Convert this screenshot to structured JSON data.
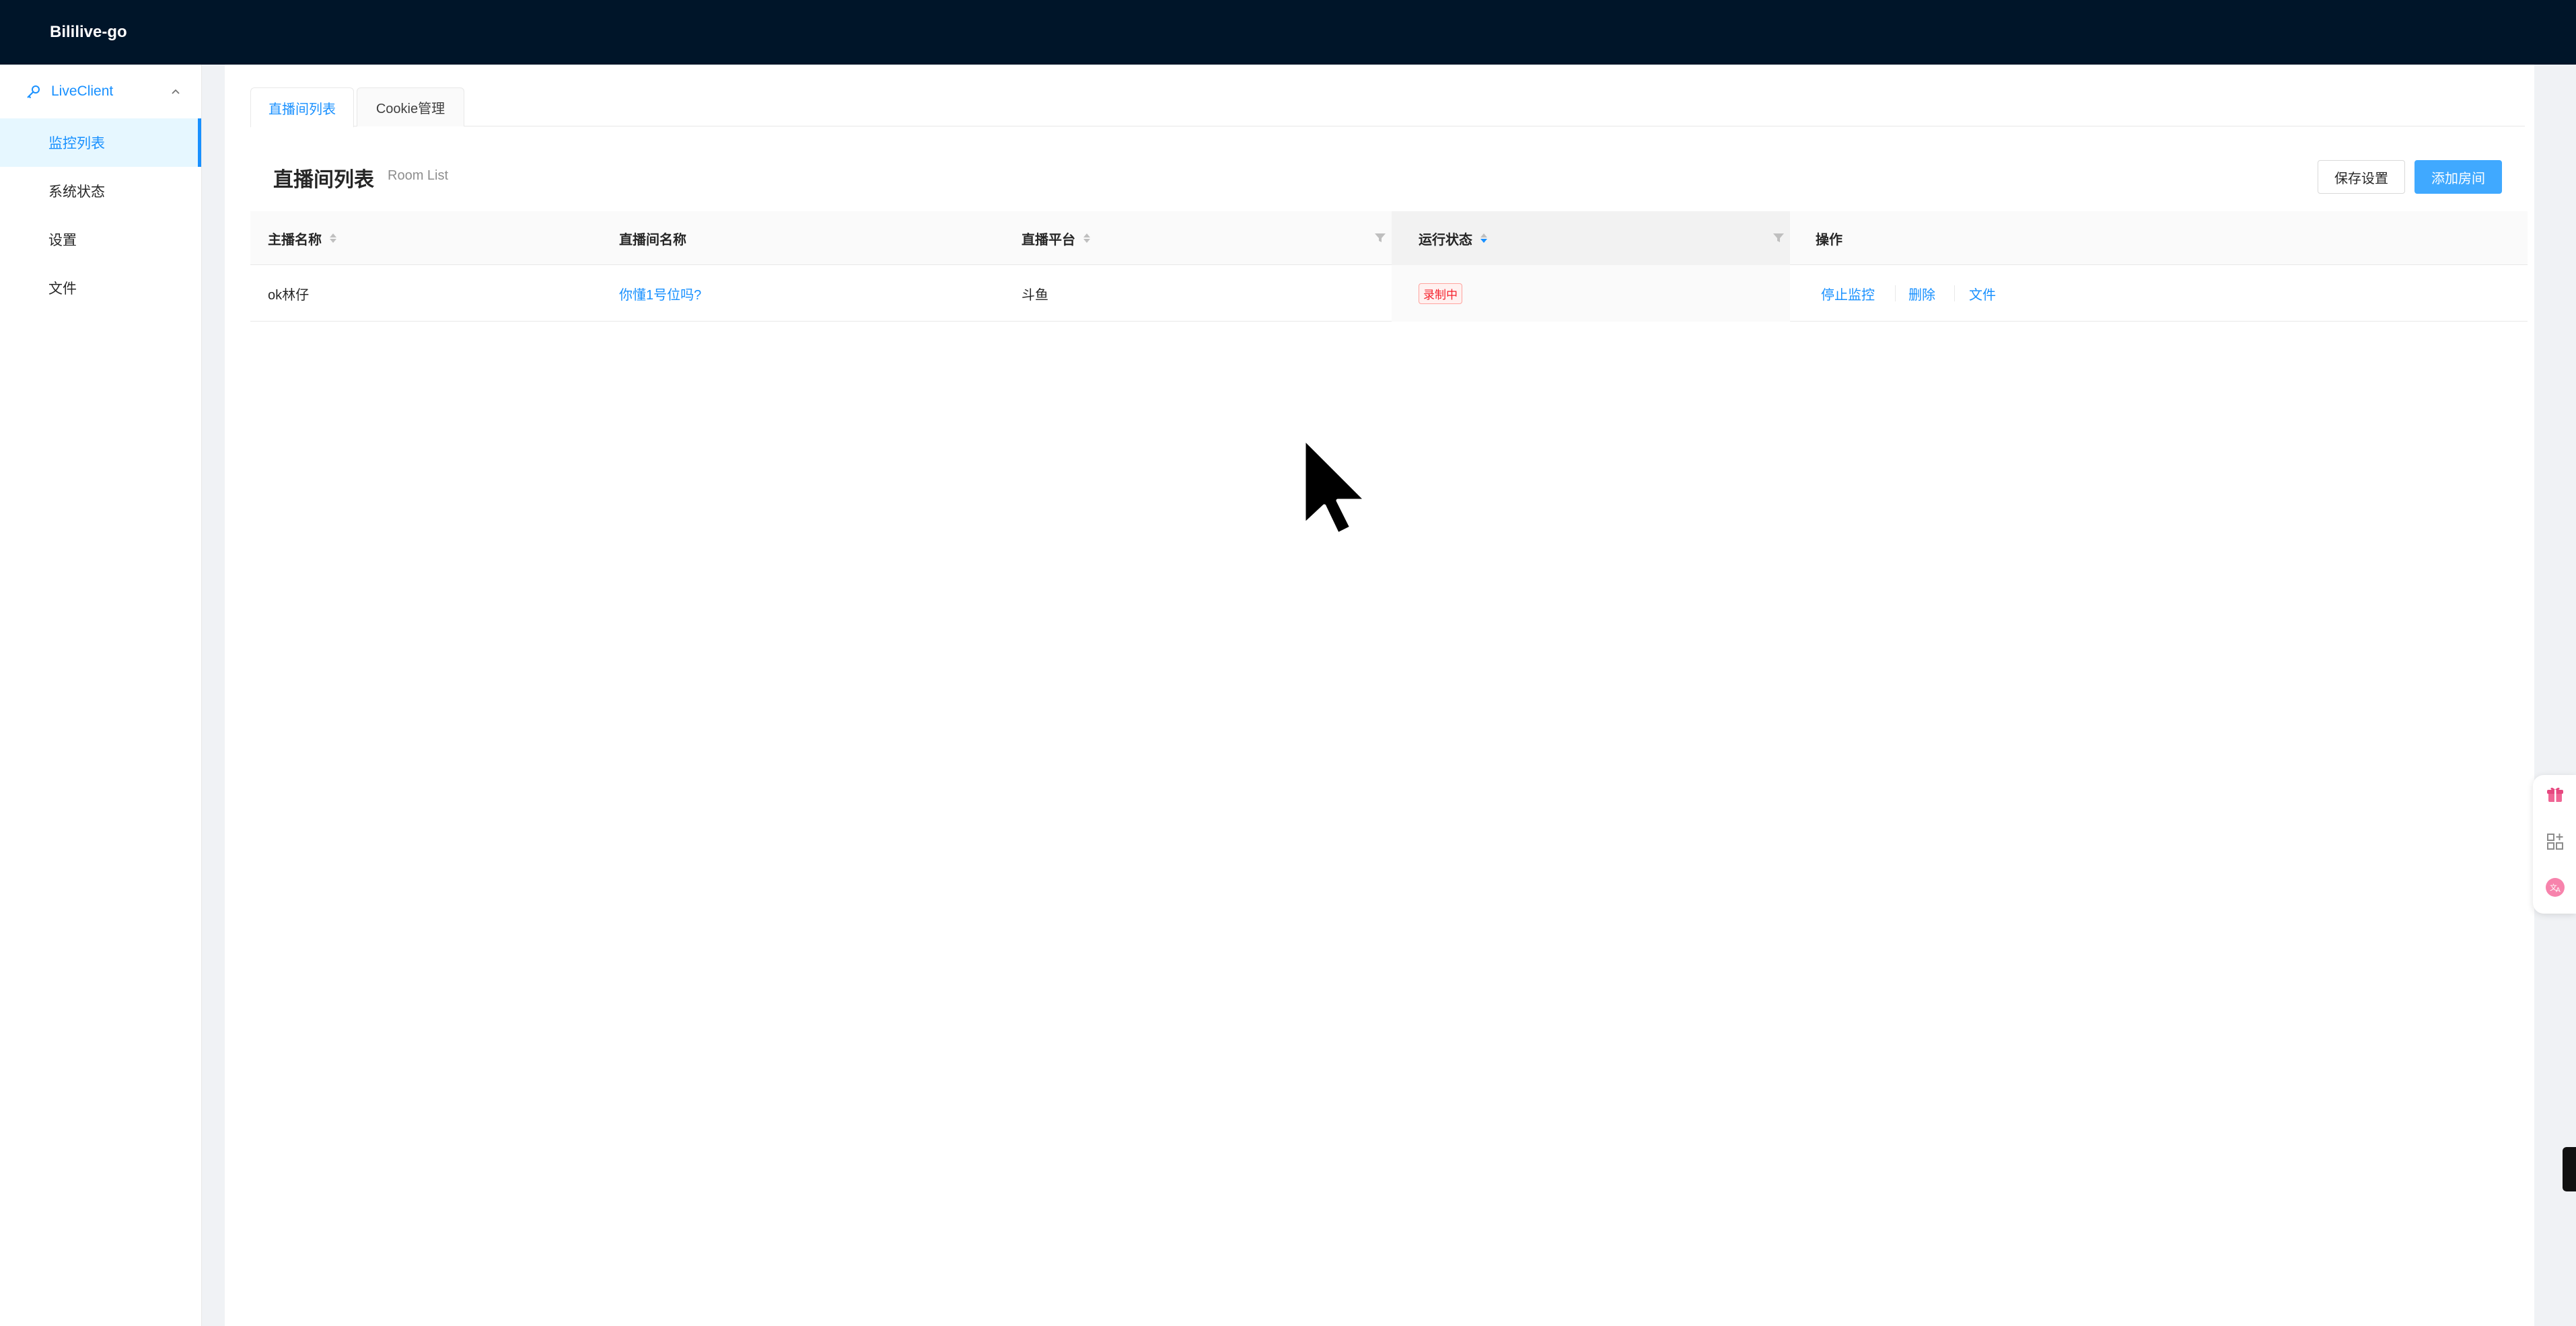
{
  "app": {
    "title": "Bililive-go"
  },
  "sidebar": {
    "group": {
      "label": "LiveClient",
      "icon": "key-icon",
      "expanded": true
    },
    "items": [
      {
        "label": "监控列表",
        "active": true
      },
      {
        "label": "系统状态",
        "active": false
      },
      {
        "label": "设置",
        "active": false
      },
      {
        "label": "文件",
        "active": false
      }
    ]
  },
  "tabs": [
    {
      "label": "直播间列表",
      "active": true
    },
    {
      "label": "Cookie管理",
      "active": false
    }
  ],
  "page": {
    "title": "直播间列表",
    "subtitle": "Room List",
    "save_button": "保存设置",
    "add_button": "添加房间"
  },
  "table": {
    "columns": [
      {
        "label": "主播名称",
        "sortable": true
      },
      {
        "label": "直播间名称",
        "sortable": false
      },
      {
        "label": "直播平台",
        "sortable": true,
        "filterable": true
      },
      {
        "label": "运行状态",
        "sortable": true,
        "sort_order": "descending",
        "filterable": true
      },
      {
        "label": "操作"
      }
    ],
    "rows": [
      {
        "host": "ok林仔",
        "room": "你懂1号位吗?",
        "platform": "斗鱼",
        "status": "录制中",
        "actions": {
          "stop": "停止监控",
          "delete": "删除",
          "files": "文件"
        }
      }
    ]
  },
  "colors": {
    "header_bg": "#001529",
    "primary": "#1890ff",
    "status_tag": "#f5222d"
  },
  "floating_icons": [
    "gift-icon",
    "qr-scan-icon",
    "translate-icon"
  ]
}
